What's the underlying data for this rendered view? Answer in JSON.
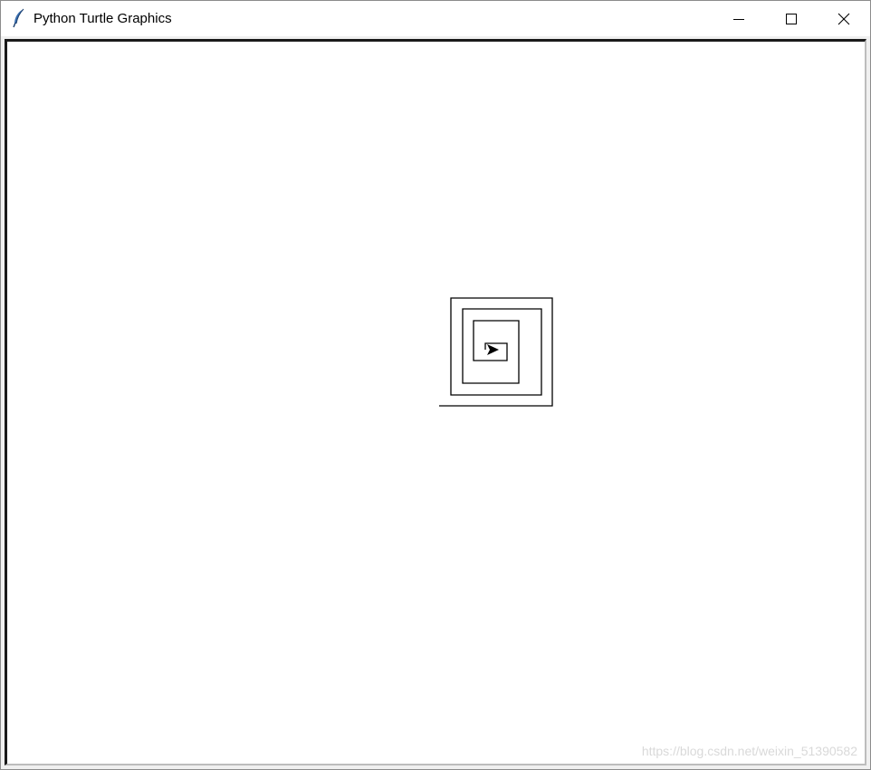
{
  "window": {
    "title": "Python Turtle Graphics",
    "app_icon": "feather-icon",
    "controls": [
      "minimize-icon",
      "maximize-icon",
      "close-icon"
    ]
  },
  "canvas": {
    "background": "#ffffff",
    "pen_color": "#000000",
    "drawing": "square-spiral",
    "turtle_shape": "arrow",
    "turtle_heading": "east"
  },
  "watermark": {
    "text": "https://blog.csdn.net/weixin_51390582"
  }
}
